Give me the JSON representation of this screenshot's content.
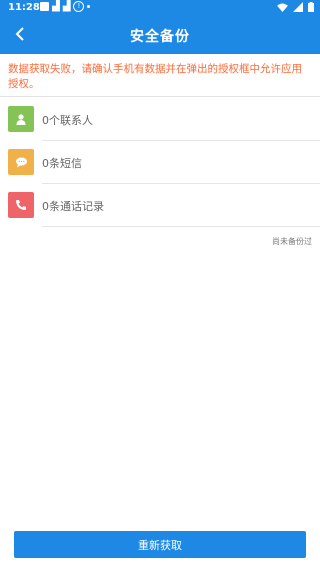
{
  "statusbar": {
    "time": "11:28"
  },
  "appbar": {
    "title": "安全备份"
  },
  "message": {
    "error_text": "数据获取失败，请确认手机有数据并在弹出的授权框中允许应用授权。"
  },
  "items": [
    {
      "label": "0个联系人",
      "icon": "contact-icon",
      "color": "#86c357"
    },
    {
      "label": "0条短信",
      "icon": "message-icon",
      "color": "#f0b14a"
    },
    {
      "label": "0条通话记录",
      "icon": "phone-icon",
      "color": "#ef6468"
    }
  ],
  "backup_status": "尚未备份过",
  "actions": {
    "refresh_label": "重新获取"
  }
}
